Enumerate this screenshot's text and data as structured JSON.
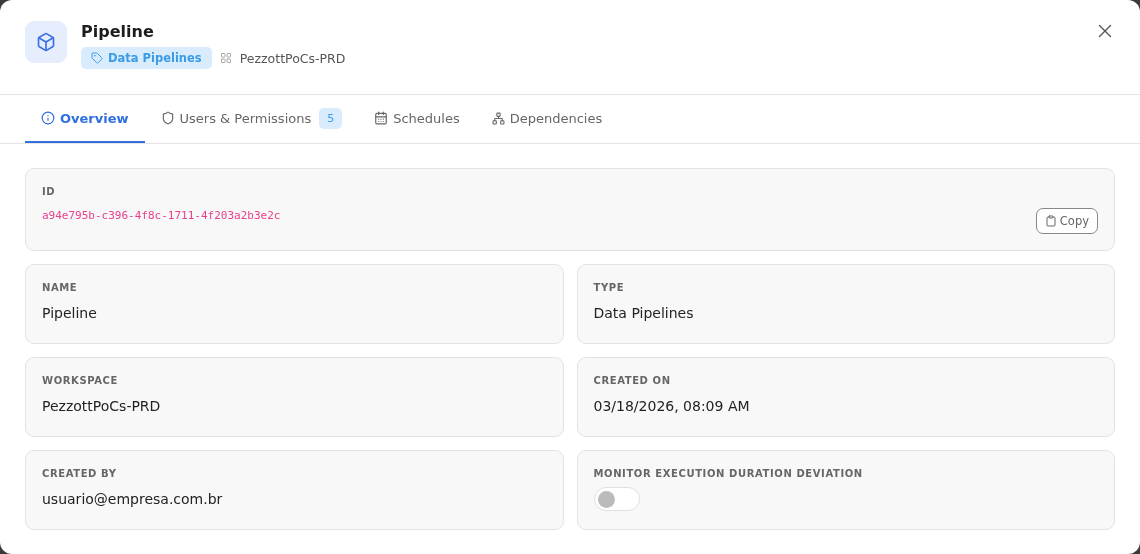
{
  "header": {
    "title": "Pipeline",
    "tag": "Data Pipelines",
    "workspace": "PezzottPoCs-PRD"
  },
  "tabs": [
    {
      "label": "Overview",
      "selected": true
    },
    {
      "label": "Users & Permissions",
      "selected": false,
      "count": "5"
    },
    {
      "label": "Schedules",
      "selected": false
    },
    {
      "label": "Dependencies",
      "selected": false
    }
  ],
  "id_card": {
    "label": "ID",
    "value": "a94e795b-c396-4f8c-1711-4f203a2b3e2c",
    "copy_button": "Copy"
  },
  "fields": [
    {
      "kind": "text",
      "label": "NAME",
      "value": "Pipeline"
    },
    {
      "kind": "text",
      "label": "TYPE",
      "value": "Data Pipelines"
    },
    {
      "kind": "text",
      "label": "WORKSPACE",
      "value": "PezzottPoCs-PRD"
    },
    {
      "kind": "text",
      "label": "CREATED ON",
      "value": "03/18/2026, 08:09 AM"
    },
    {
      "kind": "text",
      "label": "CREATED BY",
      "value": "usuario@empresa.com.br"
    },
    {
      "kind": "toggle",
      "label": "MONITOR EXECUTION DURATION DEVIATION",
      "on": false
    }
  ]
}
